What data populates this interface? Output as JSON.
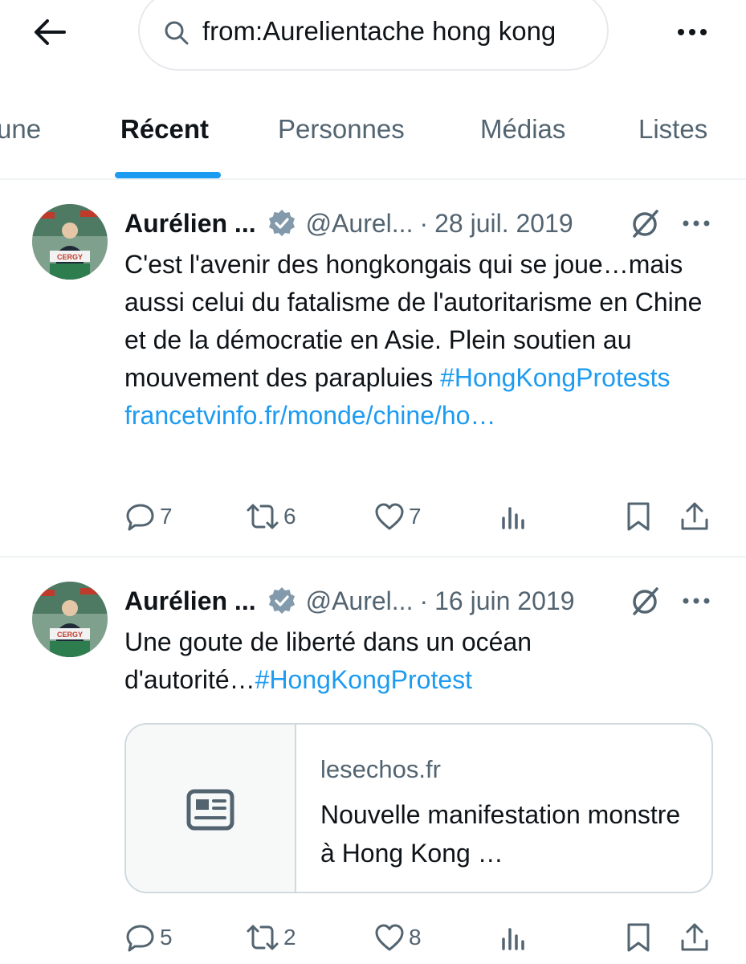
{
  "header": {
    "back_icon": "arrow-left-icon",
    "search_query": "from:Aurelientache hong kong",
    "search_icon": "search-icon",
    "more_icon": "more-horizontal-icon"
  },
  "tabs": [
    {
      "label": "À la une",
      "visible_text": "une",
      "active": false
    },
    {
      "label": "Récent",
      "active": true
    },
    {
      "label": "Personnes",
      "active": false
    },
    {
      "label": "Médias",
      "active": false
    },
    {
      "label": "Listes",
      "active": false
    }
  ],
  "colors": {
    "accent": "#1d9bf0",
    "text_primary": "#0f1419",
    "text_secondary": "#536471",
    "border": "#eff3f4",
    "verified_badge": "#829aab"
  },
  "tweets": [
    {
      "author": "Aurélien ...",
      "verified": true,
      "handle": "@Aurel...",
      "separator": "·",
      "date": "28 juil. 2019",
      "text_plain": "C'est l'avenir des hongkongais qui se joue…mais aussi celui du fatalisme de l'autoritarisme en Chine et de la démocratie en Asie. Plein soutien au mouvement des parapluies ",
      "hashtag": "#HongKongProtests",
      "url": "francetvinfo.fr/monde/chine/ho…",
      "actions": {
        "replies": "7",
        "retweets": "6",
        "likes": "7"
      }
    },
    {
      "author": "Aurélien ...",
      "verified": true,
      "handle": "@Aurel...",
      "separator": "·",
      "date": "16 juin 2019",
      "text_plain": "Une goute de liberté dans un océan d'autorité…",
      "hashtag": "#HongKongProtest",
      "card": {
        "icon": "article-icon",
        "domain": "lesechos.fr",
        "title": "Nouvelle manifestation monstre à Hong Kong …"
      },
      "actions": {
        "replies": "5",
        "retweets": "2",
        "likes": "8"
      }
    }
  ]
}
